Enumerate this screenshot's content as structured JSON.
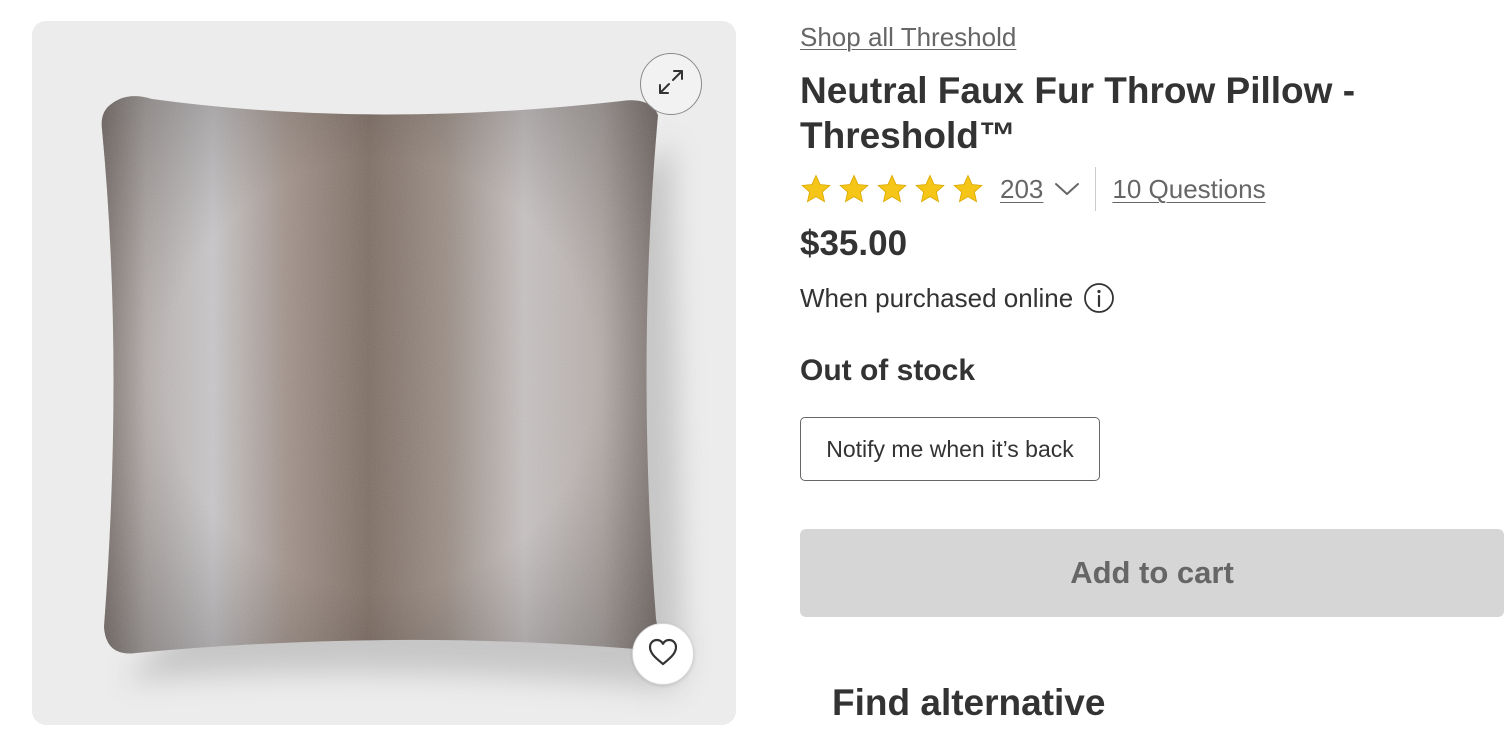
{
  "product_image": {
    "expand_icon": "expand-arrows-icon",
    "favorite_icon": "heart-icon"
  },
  "product": {
    "shop_all_link": "Shop all Threshold",
    "title": "Neutral Faux Fur Throw Pillow - Threshold™",
    "rating": {
      "stars": 5,
      "max_stars": 5,
      "star_color": "#F5C518",
      "review_count": "203",
      "questions_link": "10 Questions"
    },
    "price": "$35.00",
    "price_note": "When purchased online",
    "stock_status": "Out of stock",
    "notify_button": "Notify me when it’s back",
    "add_to_cart_button": "Add to cart",
    "find_alternative": "Find alternative"
  },
  "colors": {
    "text_primary": "#333333",
    "text_secondary": "#666666",
    "disabled_button_bg": "#D6D6D6",
    "image_background": "#ECECEC"
  }
}
